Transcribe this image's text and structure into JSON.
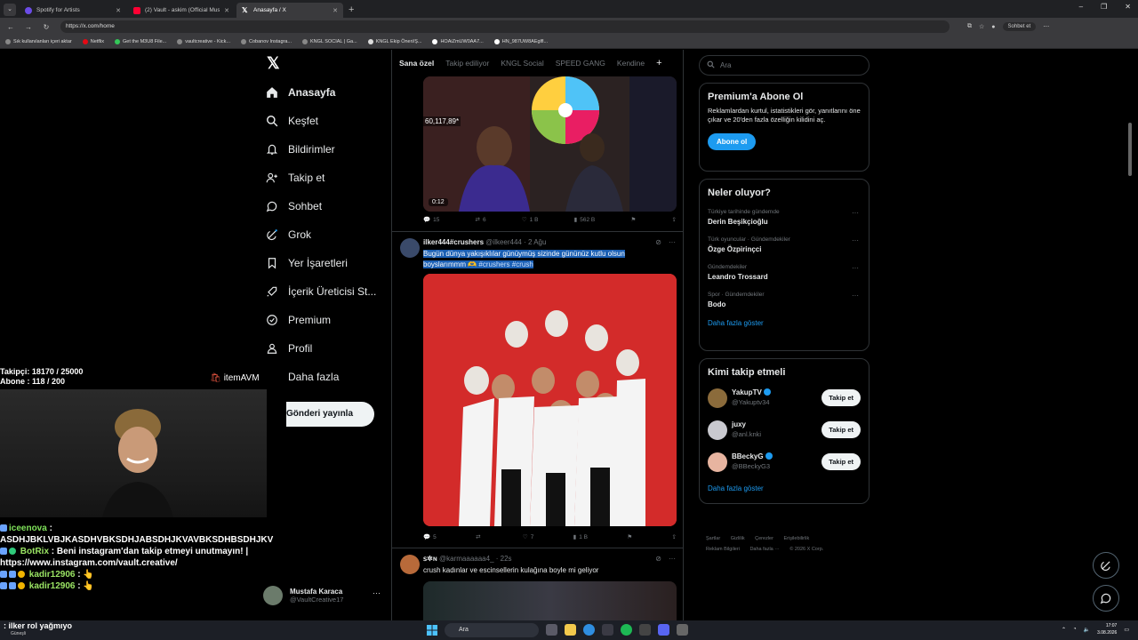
{
  "browser": {
    "tabs": [
      {
        "title": "Spotify for Artists",
        "color": "#6b4ce6"
      },
      {
        "title": "(2) Vault - askim (Official Music Vi",
        "color": "#ff0033"
      },
      {
        "title": "Anasayfa / X",
        "color": "#ffffff"
      }
    ],
    "url": "https://x.com/home",
    "chat_label": "Sohbet et",
    "bookmarks": [
      "Sık kullanılanları içeri aktar",
      "Netflix",
      "Get the M3U8 File...",
      "vaultcreative - Kick...",
      "Cobanov Instagra...",
      "KNGL SOCIAL | Ga...",
      "KNGL Ekip Öneri/Ş...",
      "HOAiZmUW0AA7...",
      "HN_987UW8AEglfl..."
    ]
  },
  "nav": {
    "items": [
      {
        "label": "Anasayfa",
        "icon": "home-icon"
      },
      {
        "label": "Keşfet",
        "icon": "search-icon"
      },
      {
        "label": "Bildirimler",
        "icon": "bell-icon"
      },
      {
        "label": "Takip et",
        "icon": "add-user-icon"
      },
      {
        "label": "Sohbet",
        "icon": "chat-icon"
      },
      {
        "label": "Grok",
        "icon": "grok-icon"
      },
      {
        "label": "Yer İşaretleri",
        "icon": "bookmark-icon"
      },
      {
        "label": "İçerik Üreticisi St...",
        "icon": "rocket-icon"
      },
      {
        "label": "Premium",
        "icon": "premium-icon"
      },
      {
        "label": "Profil",
        "icon": "profile-icon"
      },
      {
        "label": "Daha fazla",
        "icon": "more-icon"
      }
    ],
    "post_label": "Gönderi yayınla",
    "account": {
      "name": "Mustafa Karaca",
      "handle": "@VaultCreative17"
    }
  },
  "stream": {
    "followers": "Takipçi: 18170 / 25000",
    "subs": "Abone : 118 / 200",
    "brand": "itemAVM",
    "chat": [
      {
        "user": "iceenova",
        "msg": "ASDHJBKLVBJKASDHVBKSDHJABSDHJKVAVBKSDHBSDHJKV"
      },
      {
        "user": "BotRix",
        "msg": "Beni instagram'dan takip etmeyi unutmayın! |",
        "link": "https://www.instagram.com/vault.creative/"
      },
      {
        "user": "kadir12906",
        "msg": "👆"
      },
      {
        "user": "kadir12906",
        "msg": "👆"
      }
    ],
    "ticker": ": ilker rol yağmıyo"
  },
  "timeline": {
    "tabs": [
      "Sana özel",
      "Takip ediliyor",
      "KNGL Social",
      "SPEED GANG",
      "Kendine"
    ],
    "post1": {
      "counter": "60,117,89*",
      "duration": "0:12",
      "replies": "15",
      "reposts": "6",
      "likes": "1 B",
      "views": "562 B"
    },
    "post2": {
      "name": "ilker444#crushers",
      "handle": "@ilkeer444 · 2 Ağu",
      "text_sel": "Bugün dünya yakışıklılar günüymüş sizinde gününüz kutlu olsun boyslarımmm",
      "tags": "#crushers #crush",
      "replies": "5",
      "reposts": "",
      "likes": "7",
      "views": "1 B"
    },
    "post3": {
      "name": "ꜱ✲ɴ",
      "handle": "@karmaaaaaa4_ · 22s",
      "text": "crush kadınlar ve escinsellerin kulağına boyle mi geliyor"
    }
  },
  "right": {
    "search_placeholder": "Ara",
    "premium": {
      "title": "Premium'a Abone Ol",
      "body": "Reklamlardan kurtul, istatistikleri gör, yanıtlarını öne çıkar ve 20'den fazla özelliğin kilidini aç.",
      "button": "Abone ol"
    },
    "trends": {
      "title": "Neler oluyor?",
      "items": [
        {
          "context": "Türkiye tarihinde gündemde",
          "name": "Derin Beşikçioğlu"
        },
        {
          "context": "Türk oyuncular · Gündemdekiler",
          "name": "Özge Özpirinçci"
        },
        {
          "context": "Gündemdekiler",
          "name": "Leandro Trossard"
        },
        {
          "context": "Spor · Gündemdekiler",
          "name": "Bodo"
        }
      ],
      "more": "Daha fazla göster"
    },
    "who": {
      "title": "Kimi takip etmeli",
      "items": [
        {
          "name": "YakupTV",
          "handle": "@Yakuptv34",
          "verified": true
        },
        {
          "name": "juxy",
          "handle": "@anl.knki",
          "verified": false
        },
        {
          "name": "BBeckyG",
          "handle": "@BBeckyG3",
          "verified": true
        }
      ],
      "follow": "Takip et",
      "more": "Daha fazla göster"
    },
    "footer": [
      "Şartlar",
      "Gizlilik",
      "Çerezler",
      "Erişilebilirlik",
      "Reklam Bilgileri",
      "Daha fazla ···",
      "© 2026 X Corp."
    ]
  },
  "taskbar": {
    "search": "Ara",
    "weather": "Güneşli",
    "time": "17:07",
    "date": "3.08.2026"
  }
}
